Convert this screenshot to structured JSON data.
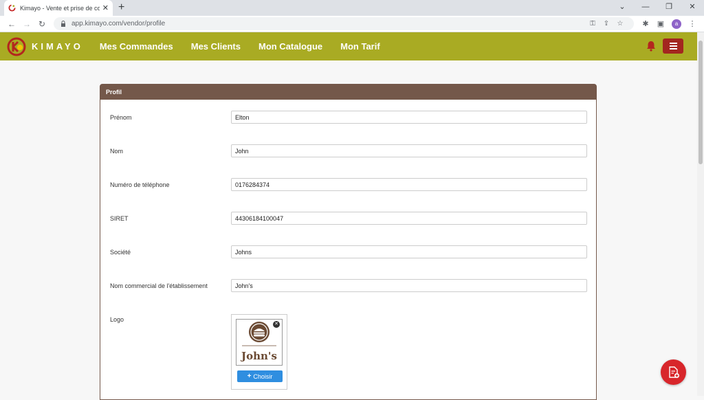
{
  "browser": {
    "tab_title": "Kimayo - Vente et prise de comm",
    "url": "app.kimayo.com/vendor/profile",
    "profile_initial": "a"
  },
  "nav": {
    "brand": "KIMAYO",
    "links": [
      "Mes Commandes",
      "Mes Clients",
      "Mon Catalogue",
      "Mon Tarif"
    ]
  },
  "panel": {
    "title": "Profil",
    "fields": [
      {
        "label": "Prénom",
        "value": "Elton"
      },
      {
        "label": "Nom",
        "value": "John"
      },
      {
        "label": "Numéro de téléphone",
        "value": "0176284374"
      },
      {
        "label": "SIRET",
        "value": "44306184100047"
      },
      {
        "label": "Société",
        "value": "Johns"
      },
      {
        "label": "Nom commercial de l'établissement",
        "value": "John's"
      }
    ],
    "logo_label": "Logo",
    "logo_text": "John's",
    "choose_label": "Choisir"
  },
  "colors": {
    "nav_bg": "#a9ab23",
    "panel_head": "#74584a",
    "menu_btn": "#a3271f",
    "choose_btn": "#2f8ee0",
    "fab": "#d8262b"
  },
  "icons": [
    "back-icon",
    "forward-icon",
    "reload-icon",
    "lock-icon",
    "key-icon",
    "share-icon",
    "star-icon",
    "extensions-icon",
    "sidepanel-icon",
    "kebab-icon",
    "bell-icon",
    "hamburger-icon",
    "plus-icon",
    "document-add-icon"
  ]
}
